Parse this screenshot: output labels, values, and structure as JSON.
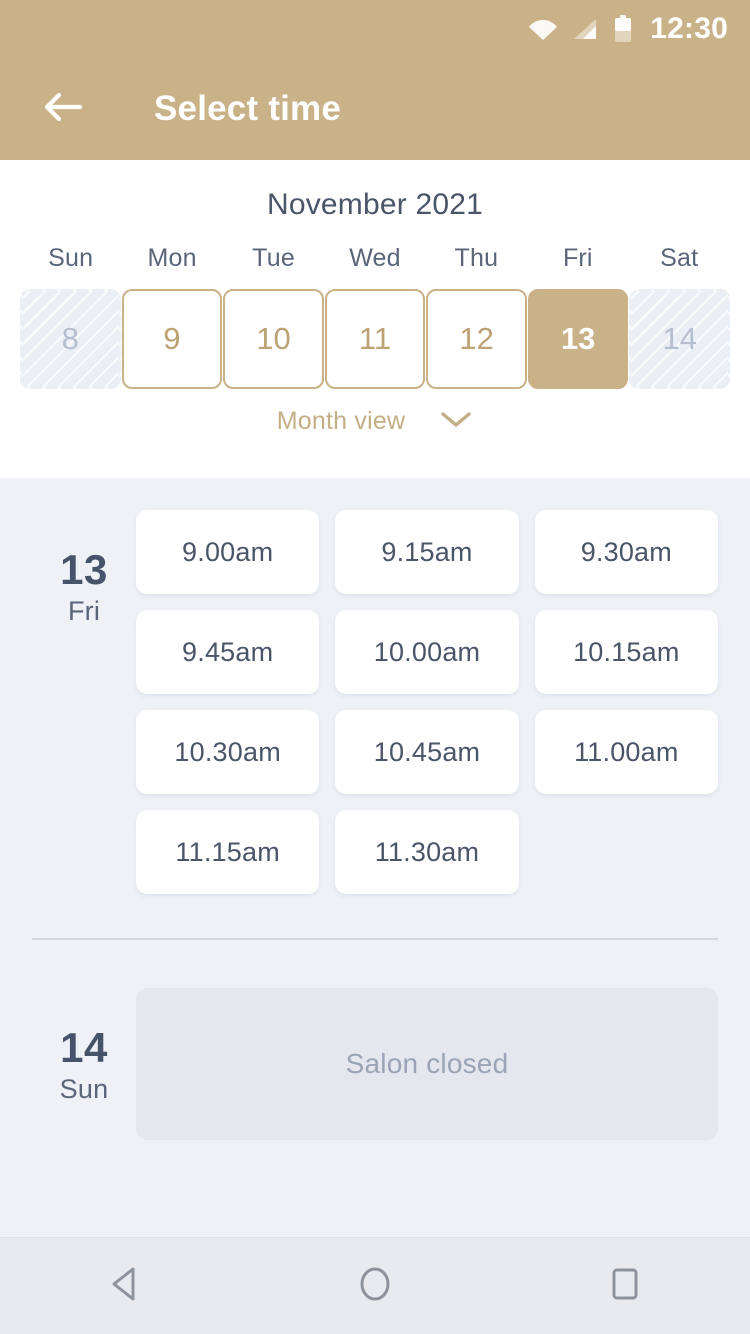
{
  "status_bar": {
    "time": "12:30",
    "icons": [
      "wifi-icon",
      "cellular-signal-icon",
      "battery-icon"
    ]
  },
  "app_bar": {
    "back_icon": "back-arrow-icon",
    "title": "Select time"
  },
  "calendar": {
    "month_title": "November 2021",
    "weekdays": [
      "Sun",
      "Mon",
      "Tue",
      "Wed",
      "Thu",
      "Fri",
      "Sat"
    ],
    "days": [
      {
        "number": "8",
        "state": "disabled"
      },
      {
        "number": "9",
        "state": "available"
      },
      {
        "number": "10",
        "state": "available"
      },
      {
        "number": "11",
        "state": "available"
      },
      {
        "number": "12",
        "state": "available"
      },
      {
        "number": "13",
        "state": "selected"
      },
      {
        "number": "14",
        "state": "disabled"
      }
    ],
    "month_view_label": "Month view",
    "month_view_icon": "chevron-down-icon"
  },
  "day_groups": [
    {
      "day_number": "13",
      "day_of_week": "Fri",
      "slots": [
        "9.00am",
        "9.15am",
        "9.30am",
        "9.45am",
        "10.00am",
        "10.15am",
        "10.30am",
        "10.45am",
        "11.00am",
        "11.15am",
        "11.30am"
      ]
    },
    {
      "day_number": "14",
      "day_of_week": "Sun",
      "closed_label": "Salon closed"
    }
  ],
  "nav_bar": {
    "back_icon": "nav-back-triangle-icon",
    "home_icon": "nav-home-circle-icon",
    "recents_icon": "nav-recents-square-icon"
  },
  "colors": {
    "accent": "#c9b288",
    "accent_text": "#bda274",
    "panel_bg": "#ffffff",
    "page_bg": "#eef1f6",
    "text_dark": "#4a5568",
    "text_muted": "#9aa4b5",
    "disabled_cell": "#eaeff5",
    "closed_box": "#e4e8ee",
    "nav_bg": "#e7eaef"
  }
}
